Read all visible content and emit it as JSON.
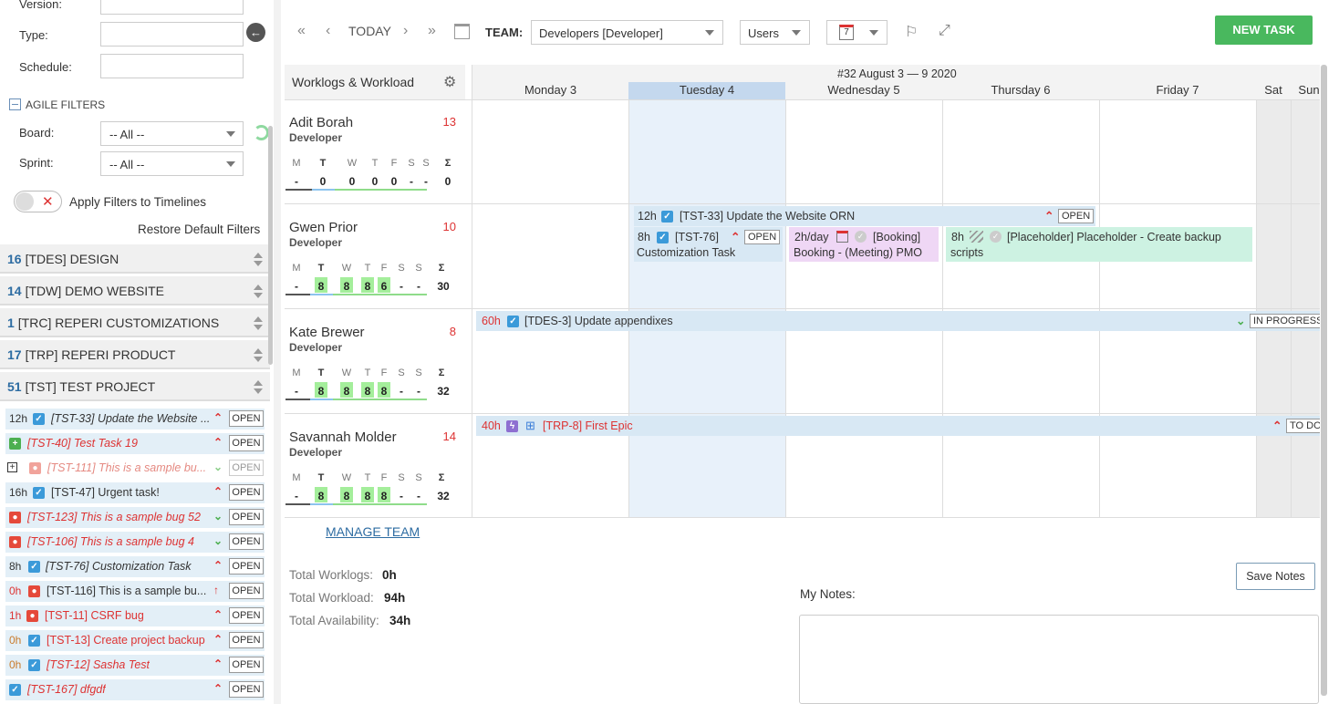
{
  "filters": {
    "version_label": "Version:",
    "type_label": "Type:",
    "schedule_label": "Schedule:",
    "agile_title": "AGILE FILTERS",
    "board_label": "Board:",
    "board_value": "-- All --",
    "sprint_label": "Sprint:",
    "sprint_value": "-- All --",
    "apply_label": "Apply Filters to Timelines",
    "restore_label": "Restore Default Filters"
  },
  "projects": [
    {
      "count": "16",
      "name": "[TDES] DESIGN"
    },
    {
      "count": "14",
      "name": "[TDW] DEMO WEBSITE"
    },
    {
      "count": "1",
      "name": "[TRC] REPERI CUSTOMIZATIONS"
    },
    {
      "count": "17",
      "name": "[TRP] REPERI PRODUCT"
    },
    {
      "count": "51",
      "name": "[TST] TEST PROJECT"
    }
  ],
  "tasks": [
    {
      "hours": "12h",
      "text": "[TST-33] Update the Website ...",
      "status": "OPEN"
    },
    {
      "hours": "",
      "text": "[TST-40] Test Task 19",
      "status": "OPEN"
    },
    {
      "hours": "",
      "text": "[TST-111] This is a sample bu...",
      "status": "OPEN"
    },
    {
      "hours": "16h",
      "text": "[TST-47] Urgent task!",
      "status": "OPEN"
    },
    {
      "hours": "",
      "text": "[TST-123] This is a sample bug 52",
      "status": "OPEN"
    },
    {
      "hours": "",
      "text": "[TST-106] This is a sample bug 4",
      "status": "OPEN"
    },
    {
      "hours": "8h",
      "text": "[TST-76] Customization Task",
      "status": "OPEN"
    },
    {
      "hours": "0h",
      "text": "[TST-116] This is a sample bu...",
      "status": "OPEN"
    },
    {
      "hours": "1h",
      "text": "[TST-11] CSRF bug",
      "status": "OPEN"
    },
    {
      "hours": "0h",
      "text": "[TST-13] Create project backup",
      "status": "OPEN"
    },
    {
      "hours": "0h",
      "text": "[TST-12] Sasha Test",
      "status": "OPEN"
    },
    {
      "hours": "",
      "text": "[TST-167] dfgdf",
      "status": "OPEN"
    }
  ],
  "toolbar": {
    "today": "TODAY",
    "team_label": "TEAM:",
    "team_value": "Developers [Developer]",
    "view_value": "Users",
    "calendar_day": "7",
    "new_task": "NEW TASK"
  },
  "grid": {
    "corner_title": "Worklogs & Workload",
    "week_title": "#32 August 3 — 9 2020",
    "days": [
      "Monday 3",
      "Tuesday 4",
      "Wednesday 5",
      "Thursday 6",
      "Friday 7",
      "Sat",
      "Sun"
    ]
  },
  "people": [
    {
      "name": "Adit Borah",
      "role": "Developer",
      "count": "13",
      "days": [
        "M",
        "T",
        "W",
        "T",
        "F",
        "S",
        "S",
        "Σ"
      ],
      "values": [
        "-",
        "0",
        "0",
        "0",
        "0",
        "-",
        "-",
        "0"
      ]
    },
    {
      "name": "Gwen Prior",
      "role": "Developer",
      "count": "10",
      "days": [
        "M",
        "T",
        "W",
        "T",
        "F",
        "S",
        "S",
        "Σ"
      ],
      "values": [
        "-",
        "8",
        "8",
        "8",
        "6",
        "-",
        "-",
        "30"
      ]
    },
    {
      "name": "Kate Brewer",
      "role": "Developer",
      "count": "8",
      "days": [
        "M",
        "T",
        "W",
        "T",
        "F",
        "S",
        "S",
        "Σ"
      ],
      "values": [
        "-",
        "8",
        "8",
        "8",
        "8",
        "-",
        "-",
        "32"
      ]
    },
    {
      "name": "Savannah Molder",
      "role": "Developer",
      "count": "14",
      "days": [
        "M",
        "T",
        "W",
        "T",
        "F",
        "S",
        "S",
        "Σ"
      ],
      "values": [
        "-",
        "8",
        "8",
        "8",
        "8",
        "-",
        "-",
        "32"
      ]
    }
  ],
  "bars": {
    "tst33": {
      "hours": "12h",
      "text": "[TST-33] Update the Website ORN",
      "status": "OPEN"
    },
    "tst76": {
      "hours": "8h",
      "text": "[TST-76]",
      "text2": "Customization Task",
      "status": "OPEN"
    },
    "booking": {
      "hours": "2h/day",
      "text": "[Booking]",
      "text2": "Booking - (Meeting) PMO"
    },
    "placeholder": {
      "hours": "8h",
      "text": "[Placeholder] Placeholder - Create backup",
      "text2": "scripts"
    },
    "tdes3": {
      "hours": "60h",
      "text": "[TDES-3] Update appendixes",
      "status": "IN PROGRESS"
    },
    "trp8": {
      "hours": "40h",
      "text": "[TRP-8] First Epic",
      "status": "TO DO"
    }
  },
  "manage_team": "MANAGE TEAM",
  "totals": {
    "worklogs_label": "Total Worklogs:",
    "worklogs_value": "0h",
    "workload_label": "Total Workload:",
    "workload_value": "94h",
    "availability_label": "Total Availability:",
    "availability_value": "34h"
  },
  "notes": {
    "label": "My Notes:",
    "save": "Save Notes"
  }
}
